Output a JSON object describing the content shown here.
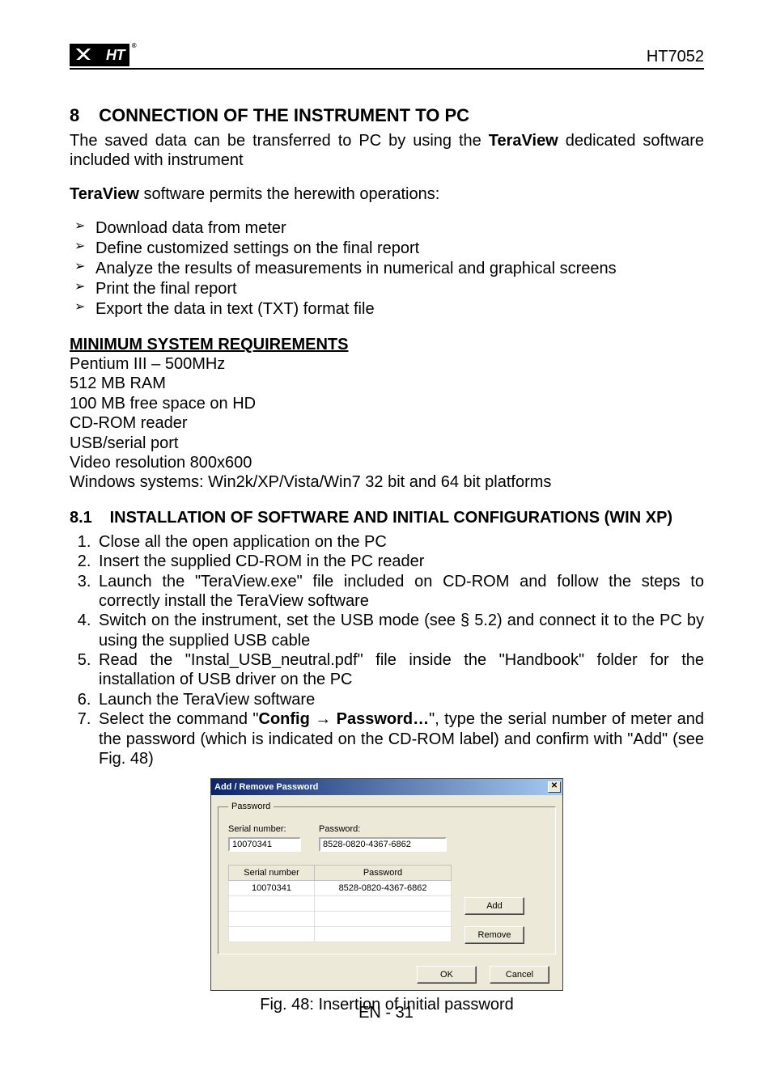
{
  "header": {
    "logo_text": "HT",
    "model": "HT7052"
  },
  "section": {
    "num": "8",
    "title": "CONNECTION OF THE INSTRUMENT TO PC"
  },
  "intro": {
    "para1_a": "The saved data can be transferred to PC by using the ",
    "para1_b": "TeraView",
    "para1_c": " dedicated software included with instrument",
    "para2_a": "TeraView",
    "para2_b": " software permits the herewith operations:"
  },
  "bullets": [
    "Download data from meter",
    "Define customized settings on the final report",
    "Analyze the results of measurements in numerical and graphical screens",
    "Print the final report",
    "Export the data in text (TXT) format file"
  ],
  "minreq": {
    "heading": "MINIMUM SYSTEM REQUIREMENTS",
    "lines": [
      "Pentium III – 500MHz",
      "512 MB RAM",
      "100 MB free space on HD",
      "CD-ROM reader",
      "USB/serial port",
      "Video resolution 800x600",
      "Windows systems: Win2k/XP/Vista/Win7 32 bit and 64 bit platforms"
    ]
  },
  "subsection": {
    "num": "8.1",
    "title": "INSTALLATION OF SOFTWARE AND INITIAL CONFIGURATIONS (WIN XP)"
  },
  "steps": [
    "Close all the open application on the PC",
    "Insert the supplied CD-ROM in the PC reader",
    "Launch the \"TeraView.exe\" file included on CD-ROM and follow the steps to correctly install the TeraView software",
    "Switch on the instrument, set the USB mode (see § 5.2) and connect it to the PC by using the supplied USB cable",
    "Read the \"Instal_USB_neutral.pdf\" file inside the \"Handbook\" folder for the installation of USB driver on the PC",
    "Launch the TeraView software"
  ],
  "step7": {
    "a": "Select the command \"",
    "b": "Config ",
    "c": "→",
    "d": " Password…",
    "e": "\", type the serial number of meter and the password (which is indicated on the CD-ROM label) and confirm with \"Add\" (see Fig. 48)"
  },
  "dialog": {
    "title": "Add / Remove  Password",
    "close": "✕",
    "groupbox": "Password",
    "sn_label": "Serial number:",
    "pw_label": "Password:",
    "sn_value": "10070341",
    "pw_value": "8528-0820-4367-6862",
    "col_sn": "Serial number",
    "col_pw": "Password",
    "row_sn": "10070341",
    "row_pw": "8528-0820-4367-6862",
    "add": "Add",
    "remove": "Remove",
    "ok": "OK",
    "cancel": "Cancel"
  },
  "caption": "Fig. 48: Insertion of initial password",
  "footer": "EN - 31"
}
